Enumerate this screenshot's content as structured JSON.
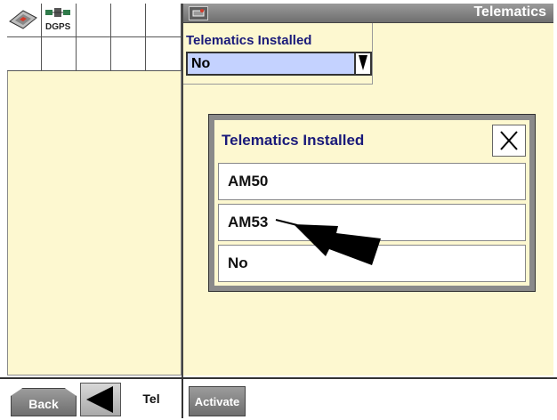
{
  "status_bar": {
    "dgps_label": "DGPS"
  },
  "header": {
    "title": "Telematics"
  },
  "field": {
    "label": "Telematics Installed",
    "value": "No"
  },
  "popup": {
    "title": "Telematics Installed",
    "options": [
      {
        "label": "AM50"
      },
      {
        "label": "AM53"
      },
      {
        "label": "No"
      }
    ]
  },
  "bottom_bar": {
    "back_label": "Back",
    "tab_label": "Tel",
    "activate_label": "Activate"
  },
  "colors": {
    "panel_bg": "#fdf8d0",
    "select_bg": "#c4d2ff",
    "label_text": "#1a1a7a",
    "bar_grey": "#8a8a8a"
  }
}
